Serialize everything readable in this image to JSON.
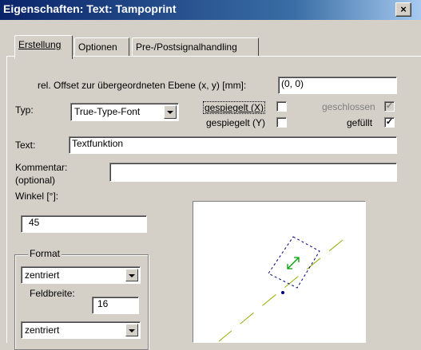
{
  "window": {
    "title": "Eigenschaften: Text: Tampoprint",
    "close_label": "×"
  },
  "tabs": [
    {
      "label": "Erstellung"
    },
    {
      "label": "Optionen"
    },
    {
      "label": "Pre-/Postsignalhandling"
    }
  ],
  "form": {
    "offset_label": "rel. Offset zur übergeordneten Ebene (x, y) [mm]:",
    "offset_value": "(0, 0)",
    "typ_label": "Typ:",
    "typ_value": "True-Type-Font",
    "mirror_x_label": "gespiegelt (X)",
    "mirror_x_checked": false,
    "mirror_y_label": "gespiegelt (Y)",
    "mirror_y_checked": false,
    "closed_label": "geschlossen",
    "closed_checked": true,
    "filled_label": "gefüllt",
    "filled_checked": true,
    "text_label": "Text:",
    "text_value": "Textfunktion",
    "comment_label": "Kommentar:",
    "comment_sub_label": "(optional)",
    "comment_value": "",
    "angle_label": "Winkel [°]:",
    "angle_value": "45"
  },
  "format": {
    "group_label": "Format",
    "align_value": "zentriert",
    "fieldwidth_label": "Feldbreite:",
    "fieldwidth_value": "16",
    "align2_value": "zentriert"
  },
  "colors": {
    "guide_line": "#8fb000",
    "frame": "#000080",
    "handle": "#00a000"
  }
}
